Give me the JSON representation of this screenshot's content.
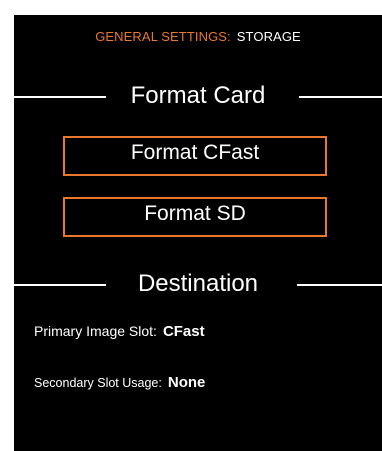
{
  "header": {
    "category": "GENERAL SETTINGS:",
    "page": "STORAGE"
  },
  "format_section": {
    "title": "Format Card",
    "buttons": [
      {
        "label": "Format CFast"
      },
      {
        "label": "Format SD"
      }
    ]
  },
  "destination_section": {
    "title": "Destination",
    "primary_slot": {
      "label": "Primary Image Slot:",
      "value": "CFast"
    },
    "secondary_usage": {
      "label": "Secondary Slot Usage:",
      "value": "None"
    }
  },
  "colors": {
    "accent": "#e8782c",
    "background": "#000000",
    "text": "#ffffff"
  }
}
